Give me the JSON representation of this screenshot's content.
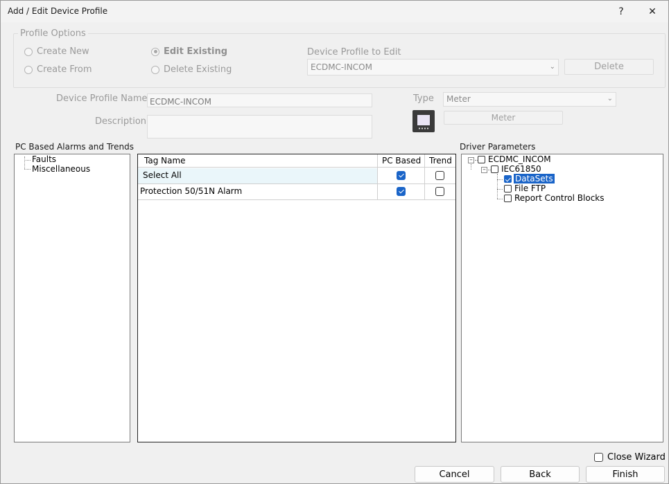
{
  "window": {
    "title": "Add / Edit Device Profile",
    "help_label": "?",
    "close_label": "✕"
  },
  "profile_options": {
    "legend": "Profile Options",
    "radios": {
      "create_new": "Create New",
      "create_from": "Create From",
      "edit_existing": "Edit Existing",
      "delete_existing": "Delete Existing"
    },
    "selected": "edit_existing",
    "device_profile_label": "Device Profile to Edit",
    "device_profile_value": "ECDMC-INCOM",
    "delete_label": "Delete"
  },
  "details": {
    "name_label": "Device Profile Name",
    "name_value": "ECDMC-INCOM",
    "description_label": "Description",
    "description_value": "",
    "type_label": "Type",
    "type_value": "Meter",
    "type_button_label": "Meter",
    "icon": "meter-icon"
  },
  "alarms_tree": {
    "title": "PC Based Alarms and Trends",
    "items": [
      "Faults",
      "Miscellaneous"
    ]
  },
  "tag_grid": {
    "columns": {
      "tag_name": "Tag Name",
      "pc_based": "PC Based",
      "trend": "Trend"
    },
    "rows": [
      {
        "name": "Select All",
        "pc_based": true,
        "trend": false
      },
      {
        "name": "Protection 50/51N Alarm",
        "pc_based": true,
        "trend": false
      }
    ]
  },
  "driver_params": {
    "title": "Driver Parameters",
    "root": {
      "label": "ECDMC_INCOM",
      "checked": false,
      "expanded": true
    },
    "child": {
      "label": "IEC61850",
      "checked": false,
      "expanded": true
    },
    "leaves": [
      {
        "label": "DataSets",
        "checked": true,
        "selected": true
      },
      {
        "label": "File FTP",
        "checked": false,
        "selected": false
      },
      {
        "label": "Report Control Blocks",
        "checked": false,
        "selected": false
      }
    ]
  },
  "footer": {
    "close_wizard_label": "Close Wizard",
    "close_wizard_checked": false,
    "cancel_label": "Cancel",
    "back_label": "Back",
    "finish_label": "Finish"
  },
  "colors": {
    "accent": "#1a64c8",
    "disabled_text": "#9a9a9a",
    "selected_row": "#eaf6fa"
  }
}
